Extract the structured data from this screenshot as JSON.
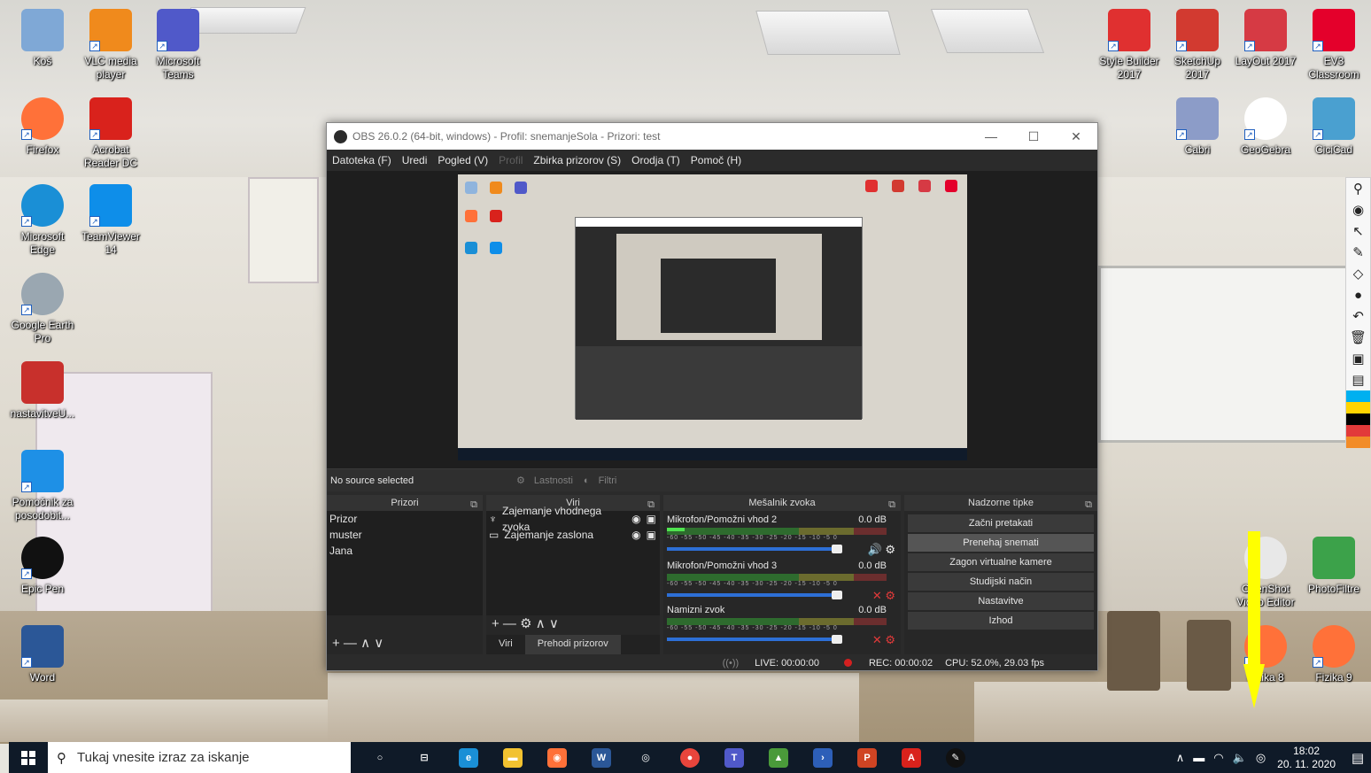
{
  "desktop": {
    "icons_left": [
      {
        "label": "Koš",
        "color": "#7fa8d6"
      },
      {
        "label": "VLC media player",
        "color": "#f08a1c"
      },
      {
        "label": "Microsoft Teams",
        "color": "#5059c9"
      },
      {
        "label": "Firefox",
        "color": "#ff7139"
      },
      {
        "label": "Acrobat Reader DC",
        "color": "#d9221c"
      },
      {
        "label": "Microsoft Edge",
        "color": "#1a8fd6"
      },
      {
        "label": "TeamViewer 14",
        "color": "#0e8ee9"
      },
      {
        "label": "Google Earth Pro",
        "color": "#9aa7b1"
      },
      {
        "label": "nastavitveU...",
        "color": "#c8302c"
      },
      {
        "label": "Pomočnik za posodobit...",
        "color": "#1e90e6"
      },
      {
        "label": "Epic Pen",
        "color": "#111111"
      },
      {
        "label": "Word",
        "color": "#2b5797"
      }
    ],
    "icons_right": [
      {
        "label": "Style Builder 2017",
        "color": "#e03030"
      },
      {
        "label": "SketchUp 2017",
        "color": "#d23a30"
      },
      {
        "label": "LayOut 2017",
        "color": "#d63a44"
      },
      {
        "label": "EV3 Classroom",
        "color": "#e4002b"
      },
      {
        "label": "Cabri",
        "color": "#8c9cc8"
      },
      {
        "label": "GeoGebra",
        "color": "#ffffff"
      },
      {
        "label": "CiciCad",
        "color": "#4aa0d0"
      },
      {
        "label": "OpenShot Video Editor",
        "color": "#e8e8e8"
      },
      {
        "label": "PhotoFiltre",
        "color": "#3ca24a"
      },
      {
        "label": "Fizika 8",
        "color": "#ff7139"
      },
      {
        "label": "Fizika 9",
        "color": "#ff7139"
      }
    ]
  },
  "obs": {
    "title": "OBS 26.0.2 (64-bit, windows) - Profil: snemanjeSola - Prizori: test",
    "window_controls": {
      "minimize": "—",
      "maximize": "☐",
      "close": "✕"
    },
    "menu": [
      "Datoteka (F)",
      "Uredi",
      "Pogled (V)",
      "Profil",
      "Zbirka prizorov (S)",
      "Orodja (T)",
      "Pomoč (H)"
    ],
    "source_bar": {
      "no_source": "No source selected",
      "properties": "Lastnosti",
      "filters": "Filtri"
    },
    "scenes": {
      "header": "Prizori",
      "items": [
        "Prizor",
        "muster",
        "Jana"
      ],
      "tools": "+ — ∧ ∨"
    },
    "sources": {
      "header": "Viri",
      "items": [
        {
          "name": "Zajemanje vhodnega zvoka",
          "icon": "mic-icon"
        },
        {
          "name": "Zajemanje zaslona",
          "icon": "monitor-icon"
        }
      ],
      "tools": "+ — ⚙ ∧ ∨",
      "tabs": [
        "Viri",
        "Prehodi prizorov"
      ]
    },
    "mixer": {
      "header": "Mešalnik zvoka",
      "scale": "-60 -55 -50 -45 -40 -35 -30 -25 -20 -15 -10 -5 0",
      "channels": [
        {
          "name": "Mikrofon/Pomožni vhod 2",
          "db": "0.0 dB",
          "level": 0.08,
          "muted": false
        },
        {
          "name": "Mikrofon/Pomožni vhod 3",
          "db": "0.0 dB",
          "level": 0,
          "muted": true
        },
        {
          "name": "Namizni zvok",
          "db": "0.0 dB",
          "level": 0,
          "muted": true
        }
      ]
    },
    "controls": {
      "header": "Nadzorne tipke",
      "buttons": [
        "Začni pretakati",
        "Prenehaj snemati",
        "Zagon virtualne kamere",
        "Studijski način",
        "Nastavitve",
        "Izhod"
      ]
    },
    "status": {
      "live": "LIVE: 00:00:00",
      "rec": "REC: 00:00:02",
      "cpu": "CPU: 52.0%, 29.03 fps"
    }
  },
  "taskbar": {
    "search_placeholder": "Tukaj vnesite izraz za iskanje",
    "apps": [
      {
        "name": "cortana",
        "glyph": "○",
        "color": "transparent"
      },
      {
        "name": "task-view",
        "glyph": "⊟",
        "color": "transparent"
      },
      {
        "name": "edge",
        "glyph": "e",
        "color": "#1a8fd6"
      },
      {
        "name": "explorer",
        "glyph": "▬",
        "color": "#f2c230"
      },
      {
        "name": "firefox",
        "glyph": "◉",
        "color": "#ff7139"
      },
      {
        "name": "word",
        "glyph": "W",
        "color": "#2b5797"
      },
      {
        "name": "obs",
        "glyph": "◎",
        "color": "transparent"
      },
      {
        "name": "chrome",
        "glyph": "●",
        "color": "#e8453c"
      },
      {
        "name": "teams",
        "glyph": "T",
        "color": "#5059c9"
      },
      {
        "name": "photo",
        "glyph": "▲",
        "color": "#4a9a3a"
      },
      {
        "name": "powershell",
        "glyph": "›",
        "color": "#2d5fb8"
      },
      {
        "name": "powerpoint",
        "glyph": "P",
        "color": "#d04423"
      },
      {
        "name": "acrobat",
        "glyph": "A",
        "color": "#d9221c"
      },
      {
        "name": "epic-pen",
        "glyph": "✎",
        "color": "#111111"
      }
    ],
    "tray": [
      "∧",
      "▬",
      "◠",
      "🔈",
      "◎"
    ],
    "time": "18:02",
    "date": "20. 11. 2020",
    "notifications": "▤"
  },
  "epic_pen": {
    "tools": [
      "⚲",
      "◉",
      "↖",
      "✎",
      "◇",
      "●",
      "↶",
      "🗑",
      "▣",
      "▤"
    ],
    "swatches": [
      "#00b0f0",
      "#ffd400",
      "#000000",
      "#e23a3a",
      "#f28c28"
    ]
  },
  "annotation": {
    "arrow_color": "#ffff00"
  }
}
